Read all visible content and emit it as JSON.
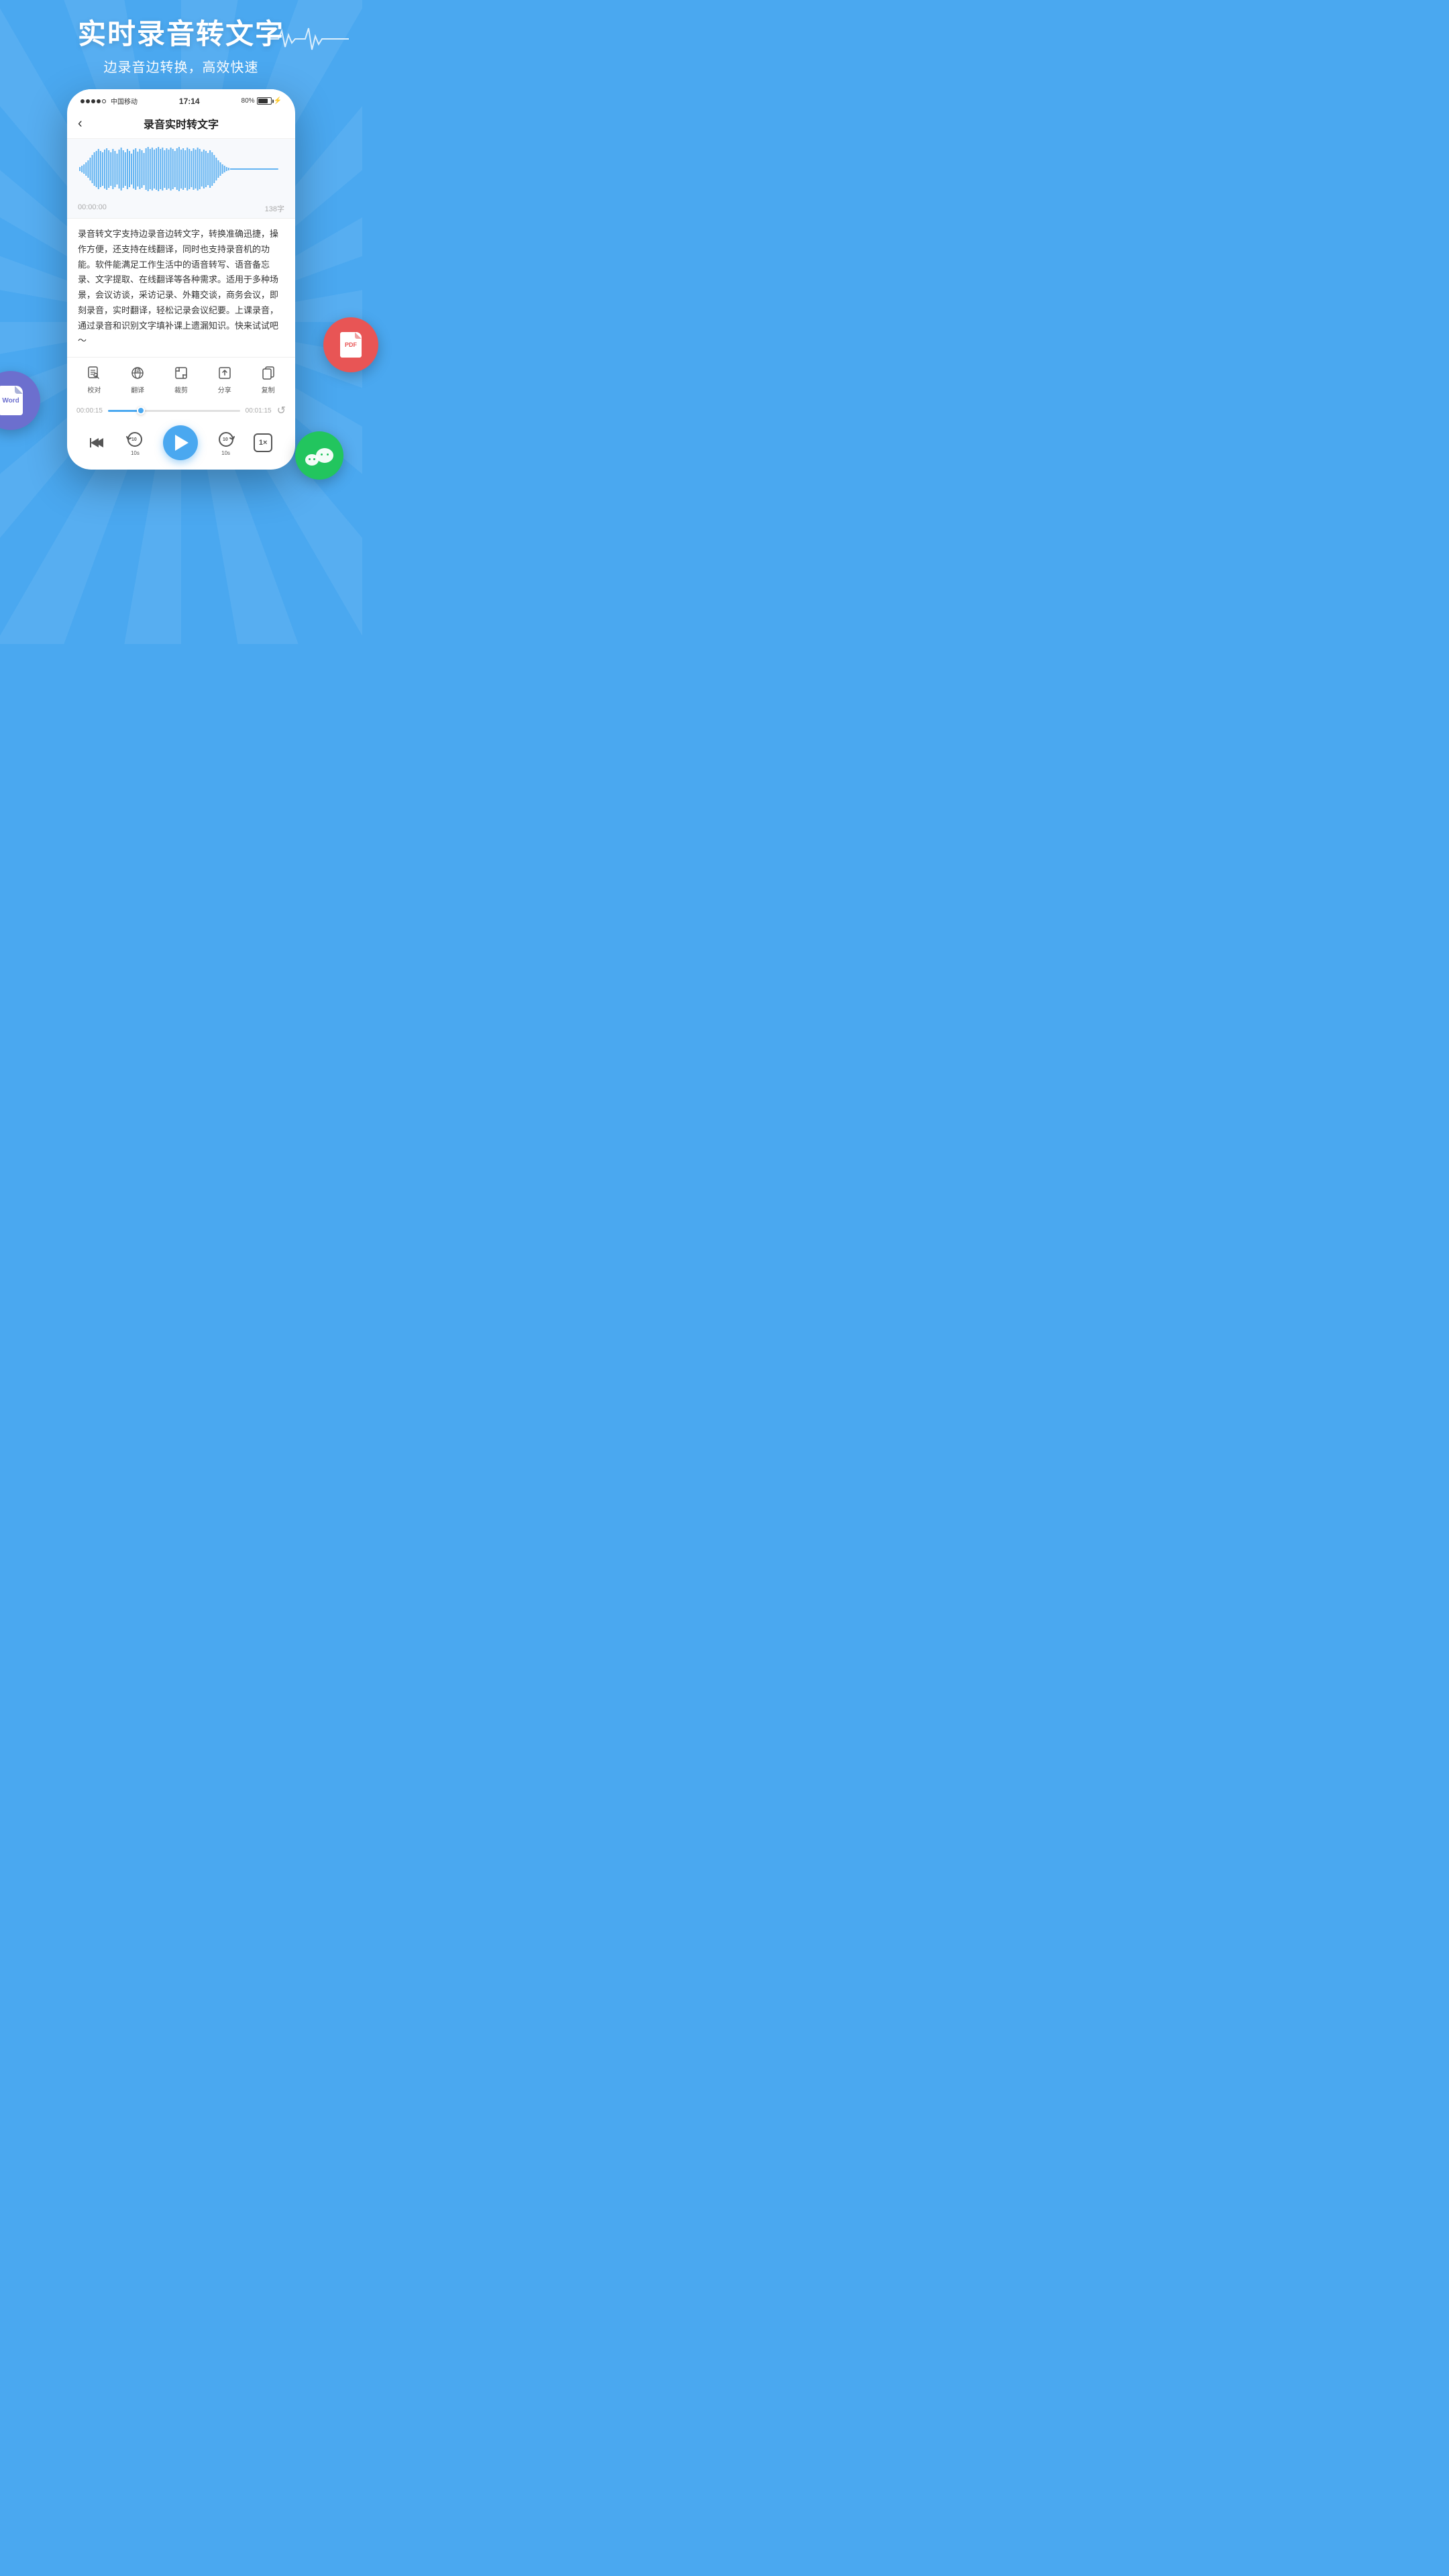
{
  "header": {
    "title": "实时录音转文字",
    "subtitle": "边录音边转换，高效快速"
  },
  "phone": {
    "status_bar": {
      "carrier": "中国移动",
      "time": "17:14",
      "battery": "80%"
    },
    "nav": {
      "back_label": "‹",
      "title": "录音实时转文字"
    },
    "waveform": {
      "timestamp": "00:00:00",
      "char_count": "138字"
    },
    "transcript": "录音转文字支持边录音边转文字，转换准确迅捷，操作方便，还支持在线翻译，同时也支持录音机的功能。软件能满足工作生活中的语音转写、语音备忘录、文字提取、在线翻译等各种需求。适用于多种场景，会议访谈，采访记录、外籍交谈，商务会议，即刻录音，实时翻译，轻松记录会议纪要。上课录音，通过录音和识别文字填补课上遗漏知识。快来试试吧～",
    "toolbar": [
      {
        "id": "proofread",
        "label": "校对",
        "icon": "✏️"
      },
      {
        "id": "translate",
        "label": "翻译",
        "icon": "🔄"
      },
      {
        "id": "trim",
        "label": "裁剪",
        "icon": "✂️"
      },
      {
        "id": "share",
        "label": "分享",
        "icon": "📤"
      },
      {
        "id": "copy",
        "label": "复制",
        "icon": "📋"
      }
    ],
    "progress": {
      "current": "00:00:15",
      "total": "00:01:15",
      "percent": 25
    },
    "playback": {
      "rewind_label": "",
      "back10_label": "10s",
      "play_label": "▶",
      "forward10_label": "10s",
      "speed_label": "1×"
    }
  },
  "float_badges": {
    "word": "Word",
    "pdf": "PDF",
    "wechat": "微信"
  }
}
